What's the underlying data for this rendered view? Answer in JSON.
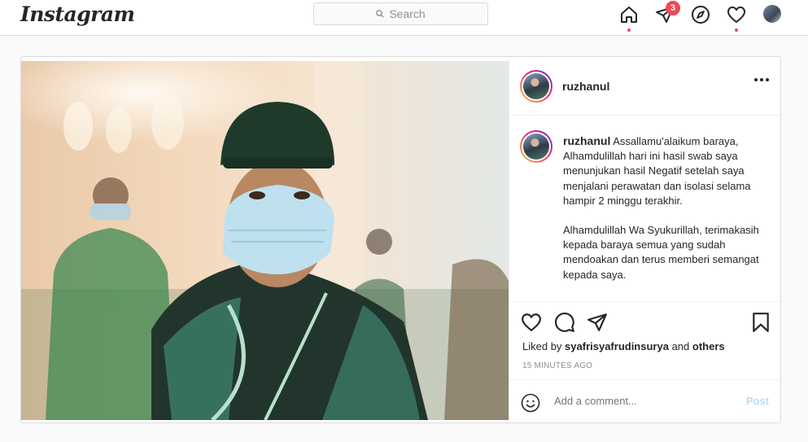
{
  "header": {
    "logo": "Instagram",
    "search_placeholder": "Search",
    "notification_count": "3",
    "icons": [
      "home-icon",
      "direct-icon",
      "explore-icon",
      "activity-icon"
    ]
  },
  "post": {
    "username": "ruzhanul",
    "caption_user": "ruzhanul",
    "caption_p1": "Assallamu'alaikum baraya, Alhamdulillah hari ini hasil swab saya menunjukan hasil Negatif setelah saya menjalani perawatan dan isolasi selama hampir 2 minggu terakhir.",
    "caption_p2": "Alhamdulillah Wa Syukurillah, terimakasih kepada baraya semua yang sudah mendoakan dan terus memberi semangat kepada saya.",
    "liked_prefix": "Liked by",
    "liked_user": "syafrisyafrudinsurya",
    "liked_and": "and",
    "liked_others": "others",
    "timestamp": "15 MINUTES AGO",
    "comment_placeholder": "Add a comment...",
    "post_button": "Post"
  },
  "colors": {
    "accent": "#ed4956",
    "post_disabled": "#b2dffc",
    "border": "#dbdbdb"
  }
}
